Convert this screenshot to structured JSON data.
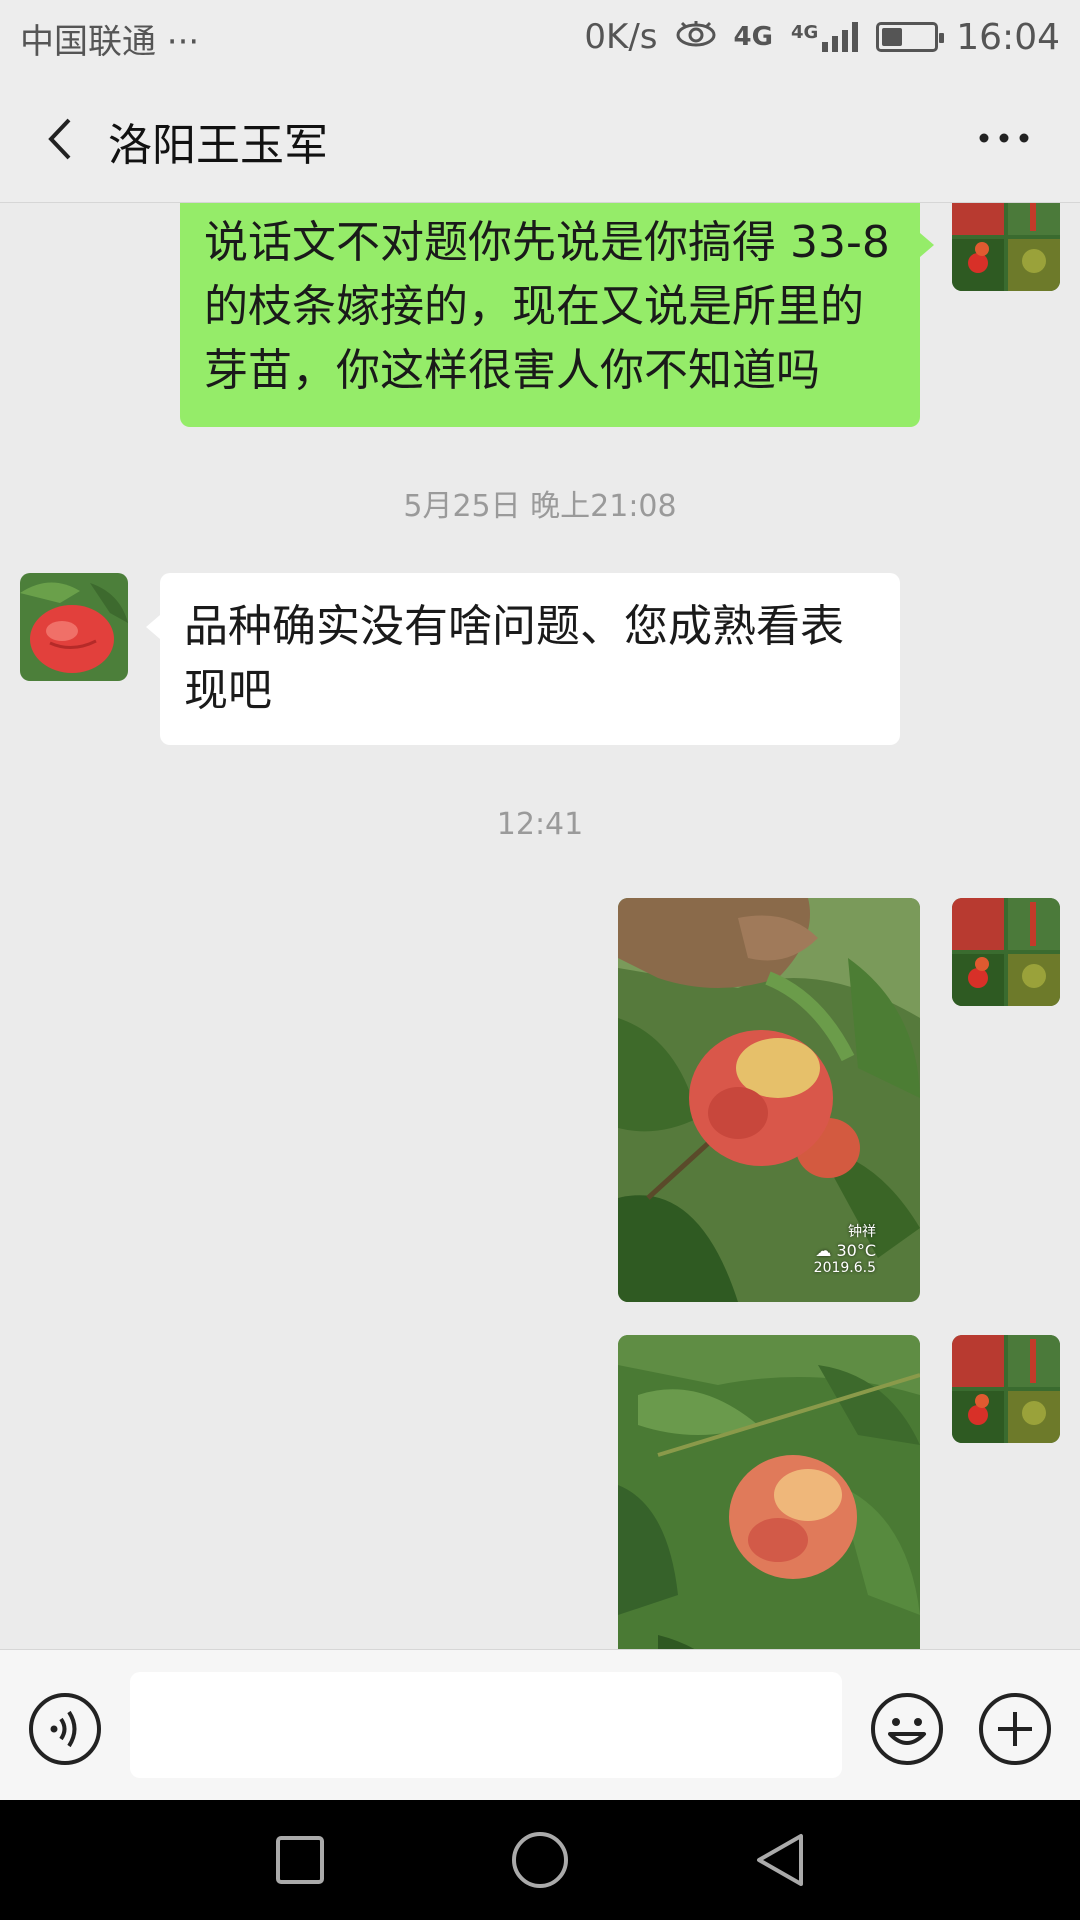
{
  "status_bar": {
    "carrier": "中国联通 ···",
    "net_speed": "0K/s",
    "network_primary": "4G",
    "network_secondary": "4G",
    "battery_level": 0.4,
    "time": "16:04"
  },
  "header": {
    "title": "洛阳王玉军"
  },
  "messages": [
    {
      "type": "text",
      "direction": "sent",
      "text": "说话文不对题你先说是你搞得 33-8 的枝条嫁接的，现在又说是所里的芽苗，你这样很害人你不知道吗"
    },
    {
      "type": "timestamp",
      "text": "5月25日 晚上21:08"
    },
    {
      "type": "text",
      "direction": "received",
      "text": "品种确实没有啥问题、您成熟看表现吧"
    },
    {
      "type": "timestamp",
      "text": "12:41"
    },
    {
      "type": "image",
      "direction": "sent",
      "watermark": {
        "name": "钟祥",
        "temperature": "30°C",
        "date": "2019.6.5"
      }
    },
    {
      "type": "image",
      "direction": "sent"
    }
  ],
  "input_bar": {
    "voice_icon": "voice-icon",
    "emoji_icon": "emoji-icon",
    "add_icon": "add-icon",
    "value": ""
  },
  "nav_bar": {
    "recent_icon": "square-icon",
    "home_icon": "circle-icon",
    "back_icon": "triangle-back-icon"
  },
  "colors": {
    "sent_bubble": "#95ec69",
    "received_bubble": "#ffffff",
    "background": "#ebebeb"
  }
}
